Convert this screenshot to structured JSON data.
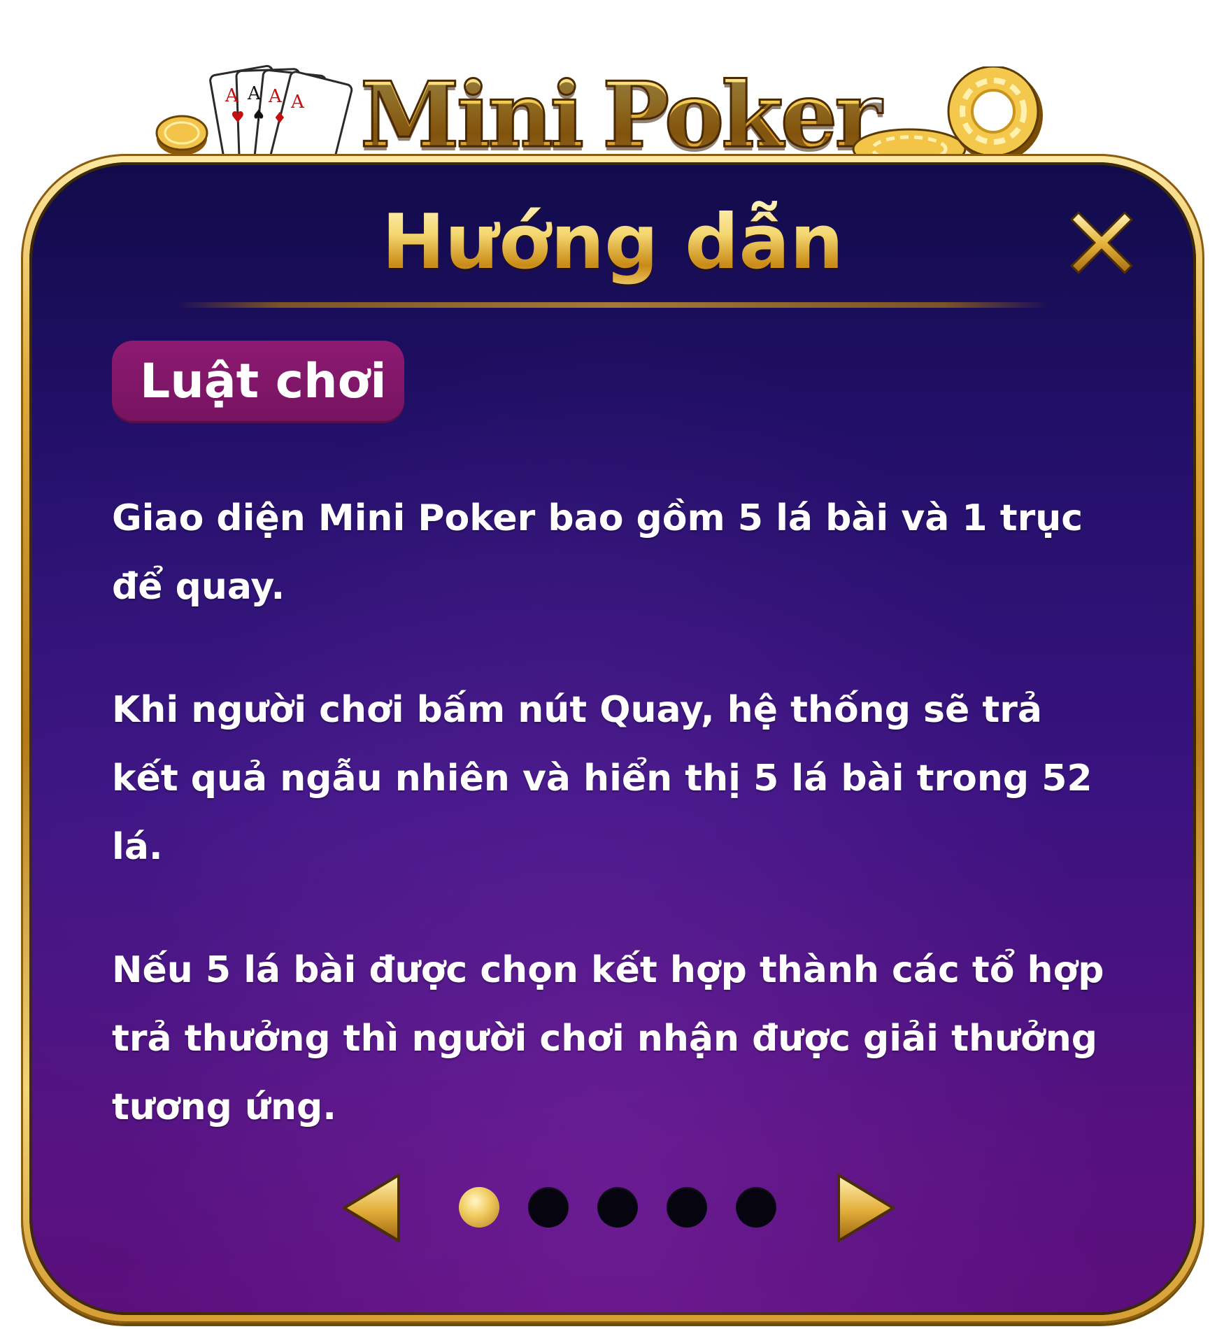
{
  "logo": {
    "word1": "Mini",
    "word2": "Poker"
  },
  "panel": {
    "title": "Hướng dẫn",
    "section_label": "Luật chơi",
    "paragraphs": [
      "Giao diện Mini Poker bao gồm 5 lá bài và 1 trục để quay.",
      "Khi người chơi bấm nút Quay, hệ thống sẽ trả kết quả ngẫu nhiên và hiển thị 5 lá bài trong 52 lá.",
      "Nếu 5 lá bài được chọn kết hợp thành các tổ hợp trả thưởng thì người chơi nhận được giải thưởng tương ứng."
    ]
  },
  "pager": {
    "total_pages": 5,
    "current_page": 1
  },
  "colors": {
    "gold": "#f0c24a",
    "panel_top": "#110b4a",
    "panel_bottom": "#5a0f7c",
    "badge": "#8d1a72"
  },
  "icons": {
    "close": "close-x-icon",
    "prev": "triangle-left-icon",
    "next": "triangle-right-icon"
  }
}
